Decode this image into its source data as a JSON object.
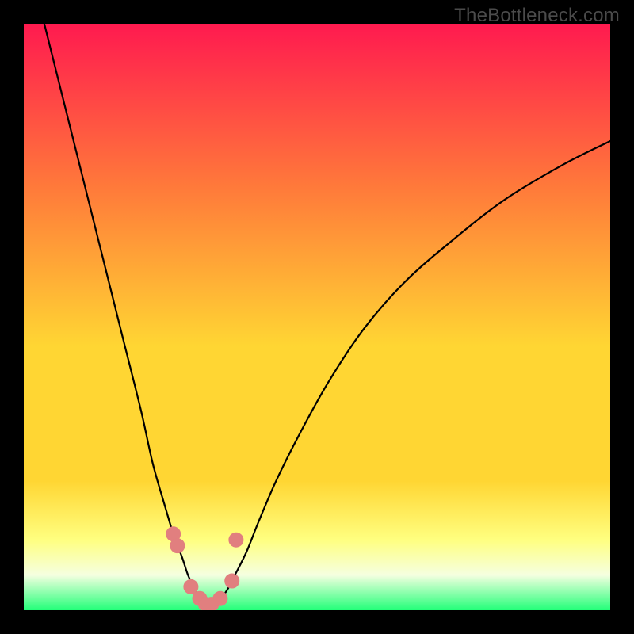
{
  "watermark": "TheBottleneck.com",
  "colors": {
    "background": "#000000",
    "gradient_top": "#ff1a4f",
    "gradient_mid_upper": "#ff7a3a",
    "gradient_mid": "#ffd633",
    "gradient_lower": "#ffff80",
    "gradient_pale": "#f5ffe0",
    "gradient_bottom": "#23ff79",
    "curve_stroke": "#000000",
    "marker_fill": "#e17f7f"
  },
  "chart_data": {
    "type": "line",
    "title": "",
    "xlabel": "",
    "ylabel": "",
    "xlim": [
      0,
      100
    ],
    "ylim": [
      0,
      100
    ],
    "grid": false,
    "description": "Bottleneck curve with minimum near x≈31 and a rounded valley of near-zero values; left branch rises steeply, right branch rises more gradually.",
    "x": [
      3,
      5,
      8,
      11,
      14,
      17,
      20,
      22,
      24,
      25.5,
      27,
      28,
      29,
      30,
      31,
      32,
      33,
      34,
      35,
      36,
      38,
      40,
      43,
      47,
      52,
      58,
      65,
      73,
      82,
      92,
      100
    ],
    "values": [
      102,
      94,
      82,
      70,
      58,
      46,
      34,
      25,
      18,
      13,
      9,
      6,
      4,
      2,
      1,
      1,
      1.5,
      2.5,
      4,
      6,
      10,
      15,
      22,
      30,
      39,
      48,
      56,
      63,
      70,
      76,
      80
    ],
    "markers": {
      "x": [
        25.5,
        26.2,
        28.5,
        30,
        31,
        32,
        33.5,
        35.5,
        36.2
      ],
      "values": [
        13,
        11,
        4,
        2,
        1,
        1,
        2,
        5,
        12
      ]
    }
  }
}
